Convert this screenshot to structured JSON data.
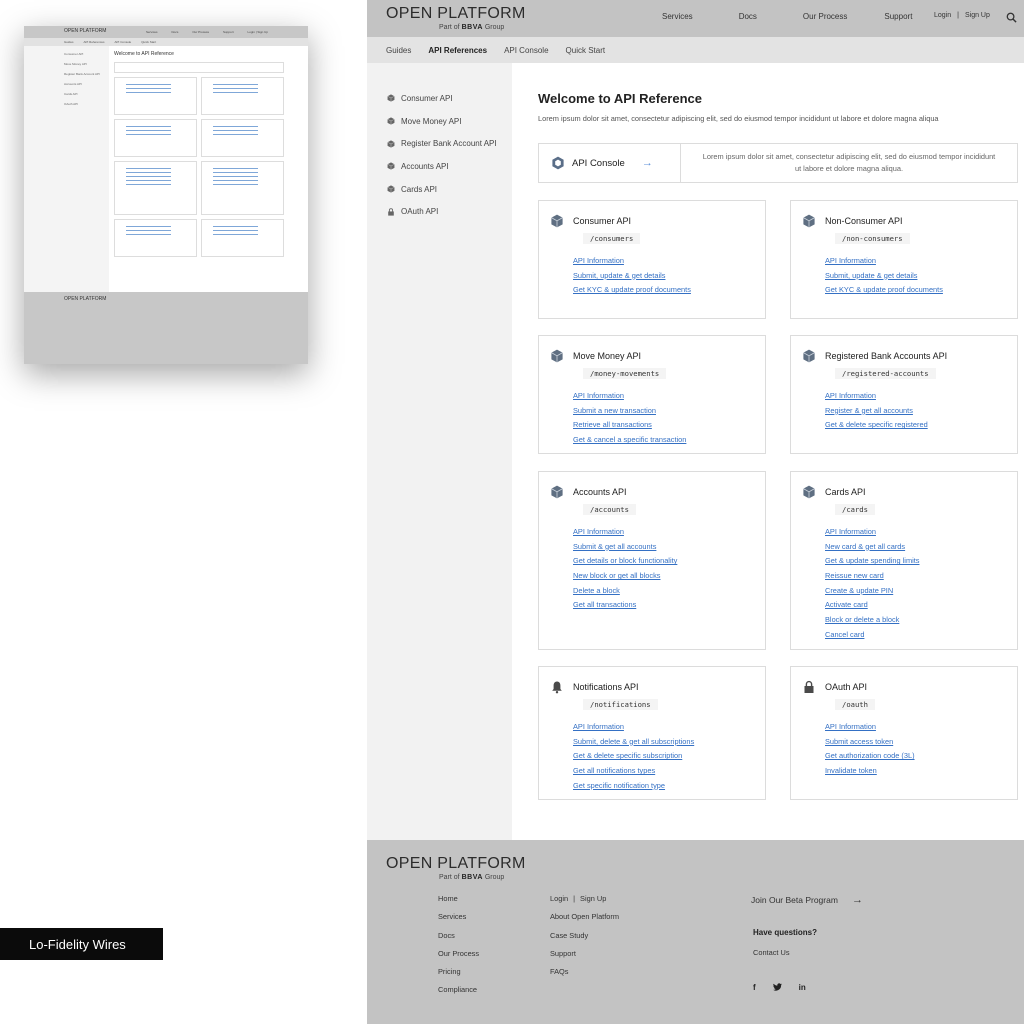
{
  "thumbnail": {
    "logo": "OPEN PLATFORM",
    "nav": [
      "Services",
      "Docs",
      "Our Process",
      "Support",
      "Login | Sign Up"
    ],
    "subnav": [
      "Guides",
      "API References",
      "API Console",
      "Quick Start"
    ],
    "title": "Welcome to API Reference"
  },
  "label": "Lo-Fidelity Wires",
  "brand": {
    "name": "OPEN PLATFORM",
    "part_of": "Part of",
    "org": "BBVA",
    "group": "Group"
  },
  "topnav": [
    "Services",
    "Docs",
    "Our Process",
    "Support"
  ],
  "auth": {
    "login": "Login",
    "separator": "|",
    "signup": "Sign Up"
  },
  "subnav": [
    {
      "label": "Guides",
      "active": false
    },
    {
      "label": "API References",
      "active": true
    },
    {
      "label": "API Console",
      "active": false
    },
    {
      "label": "Quick Start",
      "active": false
    }
  ],
  "sidebar": [
    {
      "label": "Consumer API",
      "icon": "cube-icon"
    },
    {
      "label": "Move Money API",
      "icon": "money-cube-icon"
    },
    {
      "label": "Register Bank Account API",
      "icon": "bank-cube-icon"
    },
    {
      "label": "Accounts API",
      "icon": "accounts-cube-icon"
    },
    {
      "label": "Cards API",
      "icon": "cards-cube-icon"
    },
    {
      "label": "OAuth API",
      "icon": "lock-icon"
    }
  ],
  "main": {
    "title": "Welcome to API Reference",
    "lead": "Lorem ipsum dolor sit amet, consectetur adipiscing elit, sed do eiusmod tempor incididunt ut labore et dolore magna aliqua",
    "console": {
      "label": "API Console",
      "arrow": "→",
      "text": "Lorem ipsum dolor sit amet, consectetur adipiscing elit, sed do eiusmod tempor incididunt ut labore et dolore magna aliqua."
    }
  },
  "cards": [
    {
      "title": "Consumer API",
      "path": "/consumers",
      "links": [
        "API Information",
        "Submit, update & get details",
        "Get KYC & update proof documents"
      ]
    },
    {
      "title": "Non-Consumer API",
      "path": "/non-consumers",
      "links": [
        "API Information",
        "Submit, update & get details",
        "Get KYC & update proof documents"
      ]
    },
    {
      "title": "Move Money API",
      "path": "/money-movements",
      "links": [
        "API Information",
        "Submit a new transaction",
        "Retrieve all transactions",
        "Get & cancel a specific transaction"
      ]
    },
    {
      "title": "Registered Bank Accounts API",
      "path": "/registered-accounts",
      "links": [
        "API Information",
        "Register & get all accounts",
        "Get & delete specific registered"
      ]
    },
    {
      "title": "Accounts API",
      "path": "/accounts",
      "links": [
        "API Information",
        "Submit & get all accounts",
        "Get details or block functionality",
        "New block or get all blocks",
        "Delete a block",
        "Get all transactions"
      ]
    },
    {
      "title": "Cards API",
      "path": "/cards",
      "links": [
        "API Information",
        "New card & get all cards",
        "Get & update spending limits",
        "Reissue new card",
        "Create & update PIN",
        "Activate card",
        "Block or delete a block",
        "Cancel card"
      ]
    },
    {
      "title": "Notifications API",
      "path": "/notifications",
      "links": [
        "API Information",
        "Submit, delete & get all subscriptions",
        "Get & delete specific subscription",
        "Get all notifications types",
        "Get specific notification type"
      ]
    },
    {
      "title": "OAuth API",
      "path": "/oauth",
      "links": [
        "API Information",
        "Submit access token",
        "Get authorization code (3L)",
        "Invalidate token"
      ]
    }
  ],
  "footer": {
    "col1": [
      "Home",
      "Services",
      "Docs",
      "Our Process",
      "Pricing",
      "Compliance"
    ],
    "col2_login": "Login",
    "col2_sep": "|",
    "col2_signup": "Sign Up",
    "col2": [
      "About Open Platform",
      "Case Study",
      "Support",
      "FAQs"
    ],
    "beta": "Join Our Beta Program",
    "beta_arrow": "→",
    "questions": "Have questions?",
    "contact": "Contact Us",
    "social": [
      "f",
      "t",
      "in"
    ]
  }
}
